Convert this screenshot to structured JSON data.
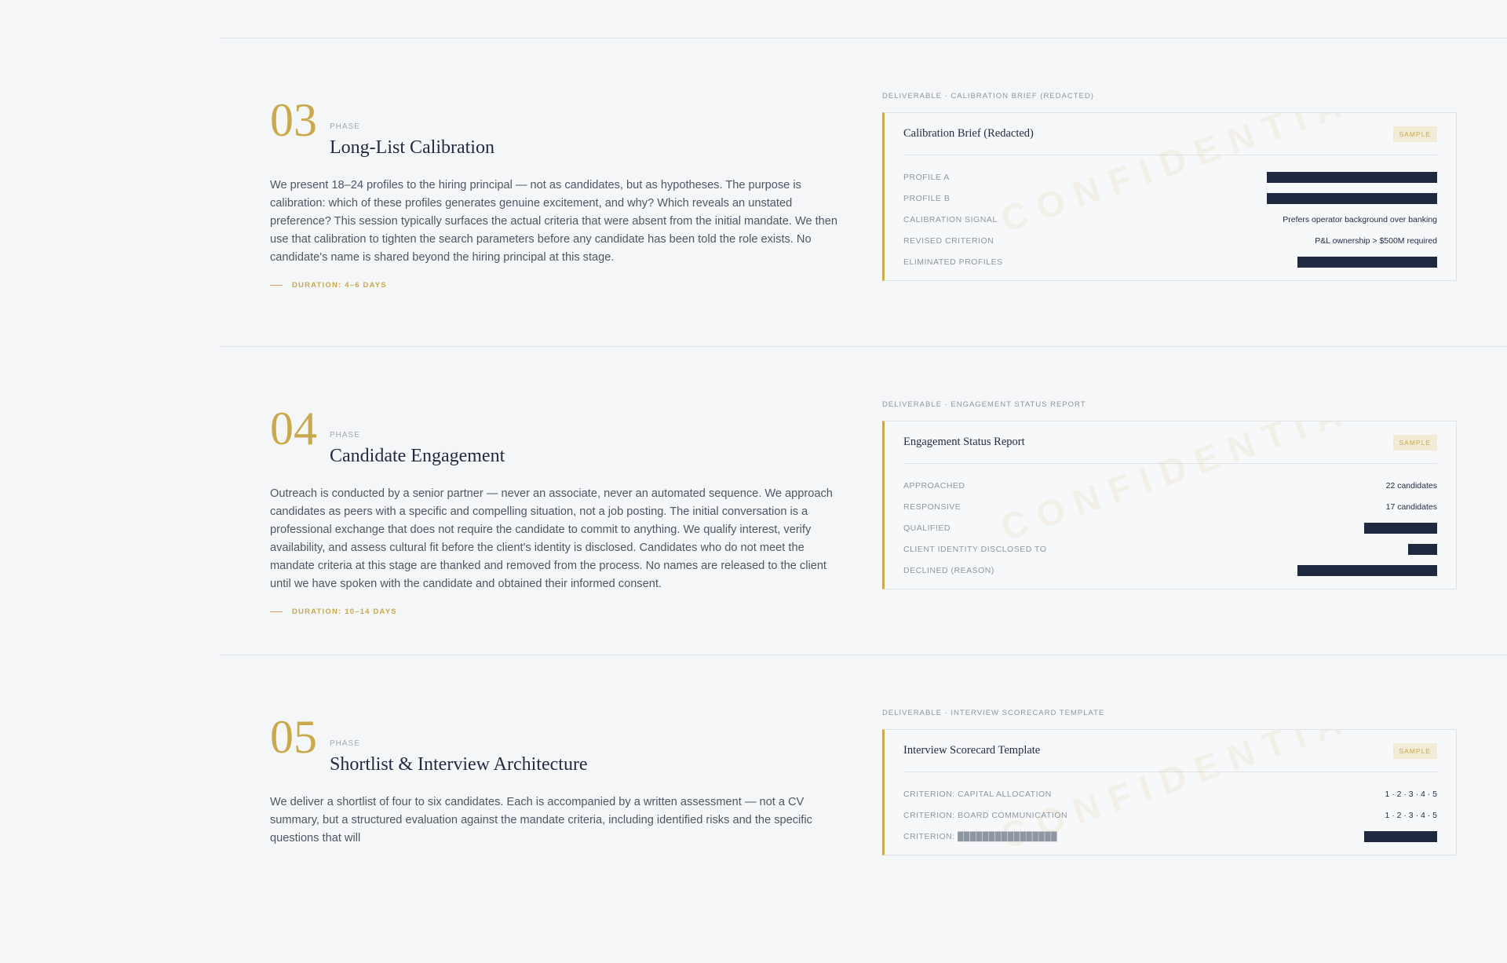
{
  "phases": [
    {
      "number": "03",
      "label": "PHASE",
      "title": "Long-List Calibration",
      "description": "We present 18–24 profiles to the hiring principal — not as candidates, but as hypotheses. The purpose is calibration: which of these profiles generates genuine excitement, and why? Which reveals an unstated preference? This session typically surfaces the actual criteria that were absent from the initial mandate. We then use that calibration to tighten the search parameters before any candidate has been told the role exists. No candidate's name is shared beyond the hiring principal at this stage.",
      "duration": "DURATION: 4–6 DAYS",
      "deliverable_label": "DELIVERABLE · CALIBRATION BRIEF (REDACTED)",
      "card": {
        "title": "Calibration Brief (Redacted)",
        "badge": "SAMPLE",
        "watermark": "CONFIDENTIAL",
        "rows": [
          {
            "label": "PROFILE A",
            "value": "",
            "redacted": 1.0
          },
          {
            "label": "PROFILE B",
            "value": "",
            "redacted": 1.0
          },
          {
            "label": "CALIBRATION SIGNAL",
            "value": "Prefers operator background over banking"
          },
          {
            "label": "REVISED CRITERION",
            "value": "P&L ownership > $500M required"
          },
          {
            "label": "ELIMINATED PROFILES",
            "value": "",
            "redacted": 0.82
          }
        ]
      }
    },
    {
      "number": "04",
      "label": "PHASE",
      "title": "Candidate Engagement",
      "description": "Outreach is conducted by a senior partner — never an associate, never an automated sequence. We approach candidates as peers with a specific and compelling situation, not a job posting. The initial conversation is a professional exchange that does not require the candidate to commit to anything. We qualify interest, verify availability, and assess cultural fit before the client's identity is disclosed. Candidates who do not meet the mandate criteria at this stage are thanked and removed from the process. No names are released to the client until we have spoken with the candidate and obtained their informed consent.",
      "duration": "DURATION: 10–14 DAYS",
      "deliverable_label": "DELIVERABLE · ENGAGEMENT STATUS REPORT",
      "card": {
        "title": "Engagement Status Report",
        "badge": "SAMPLE",
        "watermark": "CONFIDENTIAL",
        "rows": [
          {
            "label": "APPROACHED",
            "value": "22 candidates"
          },
          {
            "label": "RESPONSIVE",
            "value": "17 candidates"
          },
          {
            "label": "QUALIFIED",
            "value": "",
            "redacted": 0.43
          },
          {
            "label": "CLIENT IDENTITY DISCLOSED TO",
            "value": "",
            "redacted": 0.17
          },
          {
            "label": "DECLINED (REASON)",
            "value": "",
            "redacted": 0.82
          }
        ]
      }
    },
    {
      "number": "05",
      "label": "PHASE",
      "title": "Shortlist & Interview Architecture",
      "description": "We deliver a shortlist of four to six candidates. Each is accompanied by a written assessment — not a CV summary, but a structured evaluation against the mandate criteria, including identified risks and the specific questions that will",
      "duration": "",
      "deliverable_label": "DELIVERABLE · INTERVIEW SCORECARD TEMPLATE",
      "card": {
        "title": "Interview Scorecard Template",
        "badge": "SAMPLE",
        "watermark": "CONFIDENTIAL",
        "rows": [
          {
            "label": "CRITERION: CAPITAL ALLOCATION",
            "value": "1 · 2 · 3 · 4 · 5"
          },
          {
            "label": "CRITERION: BOARD COMMUNICATION",
            "value": "1 · 2 · 3 · 4 · 5"
          },
          {
            "label": "CRITERION: ████████████████",
            "value": "",
            "redacted": 0.43
          }
        ]
      }
    }
  ]
}
